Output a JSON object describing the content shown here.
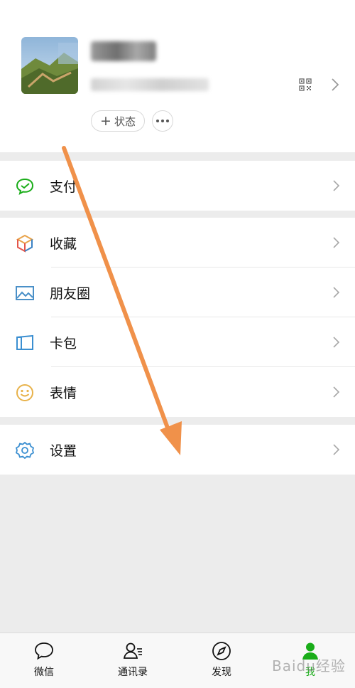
{
  "profile": {
    "status_label": "状态",
    "status_plus": "+"
  },
  "menu": {
    "pay": "支付",
    "favorites": "收藏",
    "moments": "朋友圈",
    "cards": "卡包",
    "stickers": "表情",
    "settings": "设置"
  },
  "tabbar": {
    "chats": "微信",
    "contacts": "通讯录",
    "discover": "发现",
    "me": "我"
  },
  "watermark": "Baidu经验",
  "colors": {
    "accent_green": "#1aad19",
    "arrow_orange": "#f0914a"
  }
}
